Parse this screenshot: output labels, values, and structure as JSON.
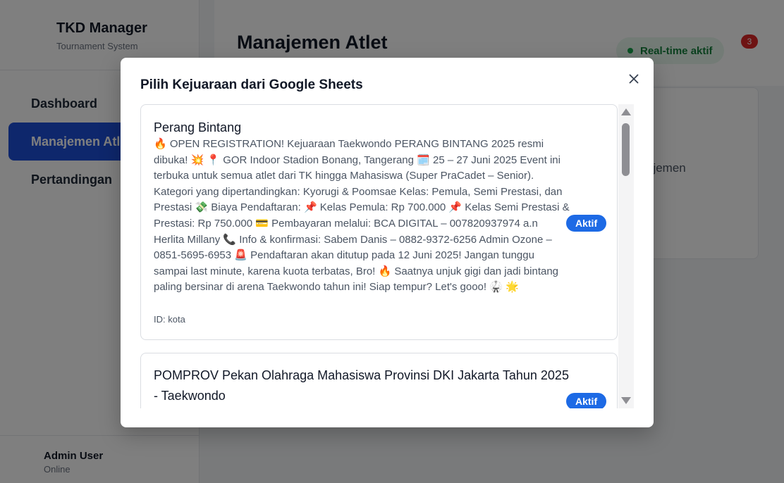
{
  "sidebar": {
    "brand_title": "TKD Manager",
    "brand_subtitle": "Tournament System",
    "items": [
      {
        "label": "Dashboard",
        "active": false
      },
      {
        "label": "Manajemen Atlet",
        "active": true
      },
      {
        "label": "Pertandingan",
        "active": false
      }
    ],
    "user": {
      "name": "Admin User",
      "status": "Online"
    }
  },
  "header": {
    "title": "Manajemen Atlet",
    "realtime_label": "Real-time aktif",
    "notification_count": "3"
  },
  "main": {
    "card_text": "ajemen"
  },
  "modal": {
    "title": "Pilih Kejuaraan dari Google Sheets",
    "close_icon": "close-icon",
    "tournaments": [
      {
        "name": "Perang Bintang",
        "description": "🔥 OPEN REGISTRATION! Kejuaraan Taekwondo PERANG BINTANG 2025 resmi dibuka! 💥 📍 GOR Indoor Stadion Bonang, Tangerang 🗓️ 25 – 27 Juni 2025 Event ini terbuka untuk semua atlet dari TK hingga Mahasiswa (Super PraCadet – Senior). Kategori yang dipertandingkan: Kyorugi & Poomsae Kelas: Pemula, Semi Prestasi, dan Prestasi 💸 Biaya Pendaftaran: 📌 Kelas Pemula: Rp 700.000 📌 Kelas Semi Prestasi & Prestasi: Rp 750.000 💳 Pembayaran melalui: BCA DIGITAL – 007820937974 a.n Herlita Millany 📞 Info & konfirmasi: Sabem Danis – 0882-9372-6256 Admin Ozone – 0851-5695-6953 🚨 Pendaftaran akan ditutup pada 12 Juni 2025! Jangan tunggu sampai last minute, karena kuota terbatas, Bro! 🔥 Saatnya unjuk gigi dan jadi bintang paling bersinar di arena Taekwondo tahun ini! Siap tempur? Let's gooo! 🥋 🌟",
        "id_text": "ID: kota",
        "status": "Aktif"
      },
      {
        "name": "POMPROV Pekan Olahraga Mahasiswa Provinsi DKI Jakarta Tahun 2025 - Taekwondo",
        "status": "Aktif"
      }
    ]
  },
  "colors": {
    "accent": "#1d4ed8",
    "status_pill": "#1d6ae5",
    "realtime_green": "#15803d",
    "badge_red": "#dc2626"
  }
}
